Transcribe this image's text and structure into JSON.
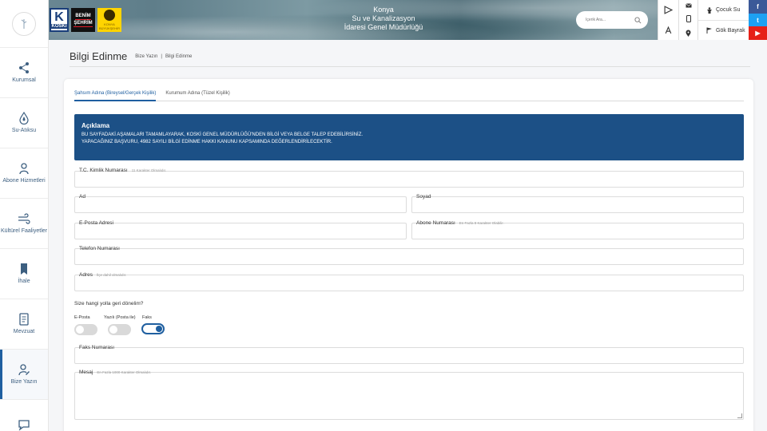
{
  "header": {
    "title_line1": "Konya",
    "title_line2": "Su ve Kanalizasyon",
    "title_line3": "İdaresi Genel Müdürlüğü",
    "logo_koski": "KOSKİ",
    "logo_bs_1": "BENİM",
    "logo_bs_2": "ŞEHRİM",
    "logo_kb_1": "KONYA",
    "logo_kb_2": "BÜYÜKŞEHİR",
    "search_placeholder": "İçerik Ara...",
    "link_cocuk": "Çocuk Su",
    "link_gok": "Gök Bayrak",
    "social_fb": "f",
    "social_tw": "t",
    "social_yt": "▶"
  },
  "sidebar": {
    "items": [
      {
        "label": "Kurumsal"
      },
      {
        "label": "Su-Atıksu"
      },
      {
        "label": "Abone Hizmetleri"
      },
      {
        "label": "Kültürel Faaliyetler"
      },
      {
        "label": "İhale"
      },
      {
        "label": "Mevzuat"
      },
      {
        "label": "Bize Yazın"
      }
    ]
  },
  "page": {
    "title": "Bilgi Edinme",
    "breadcrumb_1": "Bize Yazın",
    "breadcrumb_sep": "|",
    "breadcrumb_2": "Bilgi Edinme"
  },
  "tabs": [
    {
      "label": "Şahsım Adına (Bireysel/Gerçek Kişilik)",
      "active": true
    },
    {
      "label": "Kurumum Adına (Tüzel Kişilik)",
      "active": false
    }
  ],
  "info": {
    "title": "Açıklama",
    "line1": "BU SAYFADAKİ AŞAMALARI TAMAMLAYARAK, KOSKİ GENEL MÜDÜRLÜĞÜ'NDEN BİLGİ VEYA BELGE TALEP EDEBİLİRSİNİZ.",
    "line2": "YAPACAĞINIZ BAŞVURU, 4982 SAYILI BİLGİ EDİNME HAKKI KANUNU KAPSAMINDA DEĞERLENDİRİLECEKTİR."
  },
  "form": {
    "tc_label": "T.C. Kimlik Numarası",
    "tc_hint": "11 Karakter Olmalıdır.",
    "ad_label": "Ad",
    "soyad_label": "Soyad",
    "eposta_label": "E-Posta Adresi",
    "abone_label": "Abone Numarası",
    "abone_hint": "En Fazla 8 Karakter Olabilir.",
    "telefon_label": "Telefon Numarası",
    "adres_label": "Adres",
    "adres_hint": "İlçe dahil olmalıdır.",
    "question": "Size hangi yolla geri dönelim?",
    "opt_eposta": "E-Posta",
    "opt_yazili": "Yazılı (Posta ile)",
    "opt_faks": "Faks",
    "faks_label": "Faks Numarası",
    "mesaj_label": "Mesaj",
    "mesaj_hint": "En Fazla 1000 Karakter Olmalıdır."
  },
  "accent_color": "#1f5fa0",
  "info_bg_color": "#1c5086"
}
